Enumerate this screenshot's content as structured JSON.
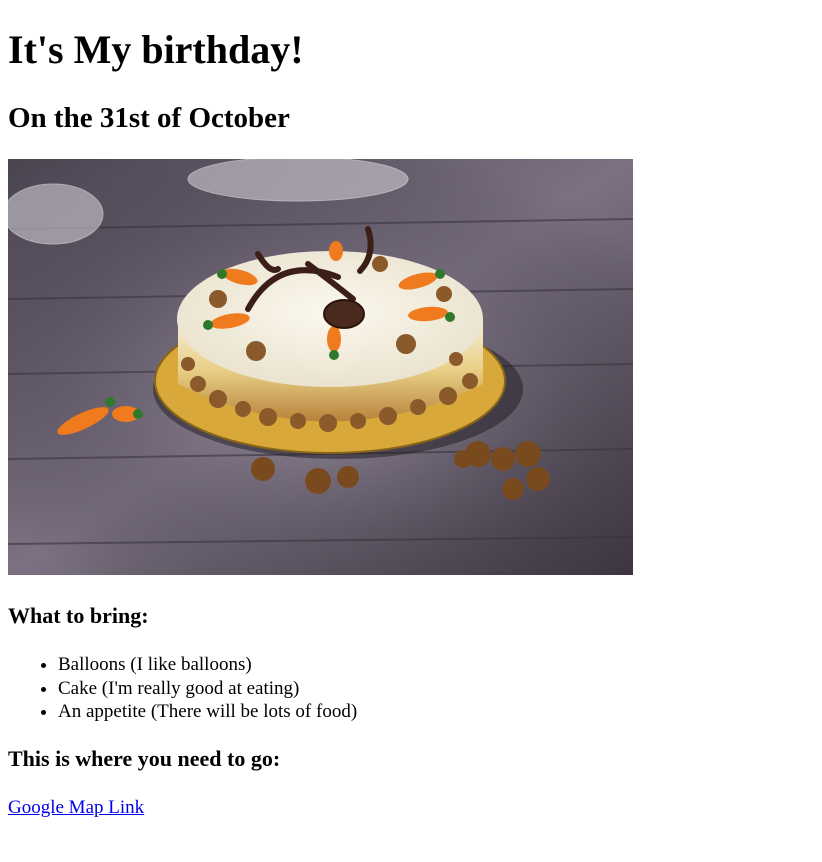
{
  "page": {
    "title": "It's My birthday!",
    "subtitle": "On the 31st of October"
  },
  "image": {
    "subject": "carrot-cake",
    "colors": {
      "table": "#5e5663",
      "table_light": "#9a8fa0",
      "frosting": "#f4efe2",
      "cake": "#e8c87a",
      "walnut": "#8a5a2b",
      "carrot": "#f07a1e",
      "leaf": "#2f7a2a",
      "chocolate": "#3b1f17",
      "board": "#d8a93a"
    }
  },
  "bring": {
    "heading": "What to bring:",
    "items": [
      "Balloons (I like balloons)",
      "Cake (I'm really good at eating)",
      "An appetite (There will be lots of food)"
    ]
  },
  "directions": {
    "heading": "This is where you need to go:",
    "link_label": "Google Map Link",
    "link_color": "#0000ee"
  }
}
